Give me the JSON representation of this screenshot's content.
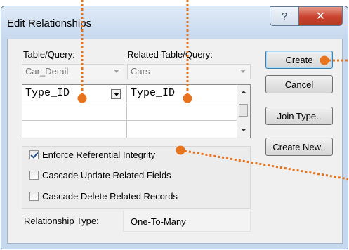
{
  "window": {
    "title": "Edit Relationships",
    "help_label": "?",
    "close_label": "✕"
  },
  "labels": {
    "table_query": "Table/Query:",
    "related_table_query": "Related Table/Query:",
    "relationship_type": "Relationship Type:"
  },
  "combos": {
    "table": "Car_Detail",
    "related_table": "Cars"
  },
  "grid": {
    "rows": [
      {
        "left": "Type_ID",
        "right": "Type_ID"
      },
      {
        "left": "",
        "right": ""
      },
      {
        "left": "",
        "right": ""
      }
    ]
  },
  "options": {
    "enforce_referential_integrity": {
      "label": "Enforce Referential Integrity",
      "checked": true
    },
    "cascade_update": {
      "label": "Cascade Update Related Fields",
      "checked": false
    },
    "cascade_delete": {
      "label": "Cascade Delete Related Records",
      "checked": false
    }
  },
  "relationship_type_value": "One-To-Many",
  "buttons": {
    "create": "Create",
    "cancel": "Cancel",
    "join_type": "Join Type..",
    "create_new": "Create New.."
  },
  "colors": {
    "annotation": "#e8731d",
    "title_bar": "#c5d8ee",
    "close_button": "#c8412d"
  }
}
